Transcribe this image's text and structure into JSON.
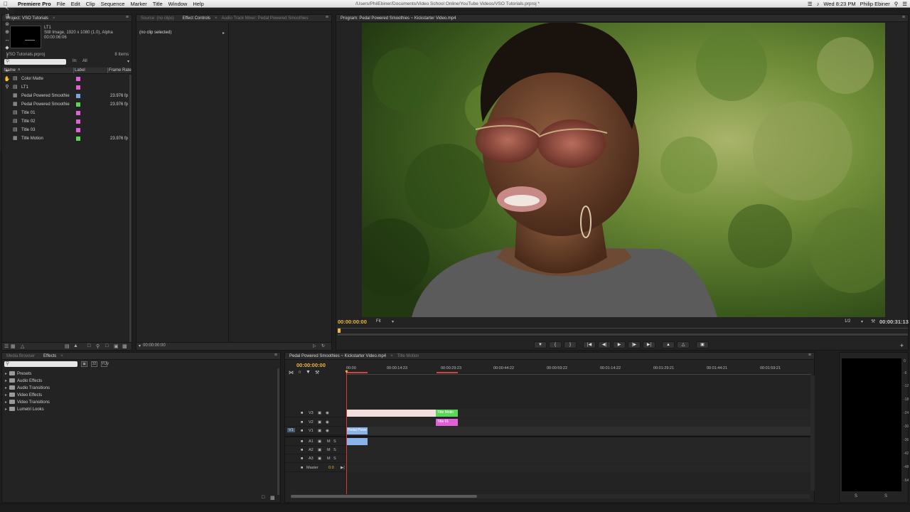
{
  "menubar": {
    "app_name": "Premiere Pro",
    "items": [
      "File",
      "Edit",
      "Clip",
      "Sequence",
      "Marker",
      "Title",
      "Window",
      "Help"
    ],
    "path": "/Users/PhilEbiner/Documents/Video School Online/YouTube Videos/VSO Tutorials.prproj *",
    "clock": "Wed 8:23 PM",
    "user": "Philip Ebiner"
  },
  "project": {
    "tab_label": "Project: VSO Tutorials",
    "clip_name": "LT1",
    "clip_info_1": "Still Image, 1920 x 1080 (1.0), Alpha",
    "clip_info_2": "00:00:06:06",
    "project_file": "VSO Tutorials.prproj",
    "item_count": "8 Items",
    "in_label": "In:",
    "in_value": "All",
    "col_name": "Name",
    "col_label": "Label",
    "col_frame_rate": "Frame Rate",
    "items": [
      {
        "name": "Color Matte",
        "label_color": "#e060d8",
        "frame_rate": "",
        "icon": "still-icon"
      },
      {
        "name": "LT1",
        "label_color": "#e060d8",
        "frame_rate": "",
        "icon": "still-icon"
      },
      {
        "name": "Pedal Powered Smoothie",
        "label_color": "#7aa6e0",
        "frame_rate": "23.976 fp",
        "icon": "sequence-icon"
      },
      {
        "name": "Pedal Powered Smoothie",
        "label_color": "#5fd45a",
        "frame_rate": "23.976 fp",
        "icon": "sequence-icon"
      },
      {
        "name": "Title 01",
        "label_color": "#e060d8",
        "frame_rate": "",
        "icon": "still-icon"
      },
      {
        "name": "Title 02",
        "label_color": "#e060d8",
        "frame_rate": "",
        "icon": "still-icon"
      },
      {
        "name": "Title 03",
        "label_color": "#e060d8",
        "frame_rate": "",
        "icon": "still-icon"
      },
      {
        "name": "Title Motion",
        "label_color": "#5fd45a",
        "frame_rate": "23.976 fp",
        "icon": "sequence-icon"
      }
    ]
  },
  "source_tabs": {
    "source": "Source: (no clips)",
    "effect_controls": "Effect Controls",
    "audio_mixer": "Audio Track Mixer: Pedal Powered Smoothies",
    "no_clip": "(no clip selected)",
    "timecode": "00:00:00:00"
  },
  "program": {
    "tab_label": "Program: Pedal Powered Smoothies ~ Kickstarter Video.mp4",
    "timecode_current": "00:00:00:00",
    "fit": "Fit",
    "resolution": "1/2",
    "timecode_duration": "00:00:31:13"
  },
  "effects_panel": {
    "tab_media_browser": "Media Browser",
    "tab_effects": "Effects",
    "folders": [
      "Presets",
      "Audio Effects",
      "Audio Transitions",
      "Video Effects",
      "Video Transitions",
      "Lumetri Looks"
    ]
  },
  "timeline": {
    "tab_sequence": "Pedal Powered Smoothies ~ Kickstarter Video.mp4",
    "tab_title_motion": "Title Motion",
    "timecode": "00:00:00:00",
    "ruler_ticks": [
      "00:00",
      "00:00:14:23",
      "00:00:29:23",
      "00:00:44:22",
      "00:00:59:22",
      "00:01:14:22",
      "00:01:29:21",
      "00:01:44:21",
      "00:01:59:21"
    ],
    "tracks": [
      {
        "name": "V3"
      },
      {
        "name": "V2"
      },
      {
        "name": "V1",
        "source": "V1"
      },
      {
        "name": "A1"
      },
      {
        "name": "A2"
      },
      {
        "name": "A3"
      }
    ],
    "master_label": "Master",
    "master_value": "0.0",
    "clips": {
      "v3_title": "Title Motio",
      "v2_title": "Title 01",
      "v1_clip": "Pedal Powe"
    }
  },
  "meters": {
    "scale": [
      "0",
      "-6",
      "-12",
      "-18",
      "-24",
      "-30",
      "-36",
      "-42",
      "-48",
      "-54"
    ],
    "solo_label": "S"
  },
  "colors": {
    "timecode_accent": "#f0b640",
    "playhead": "#dd3333",
    "clip_pink": "#f5dede",
    "clip_green": "#5fd45a",
    "clip_magenta": "#e060d8",
    "clip_blue": "#8ab4e8"
  }
}
